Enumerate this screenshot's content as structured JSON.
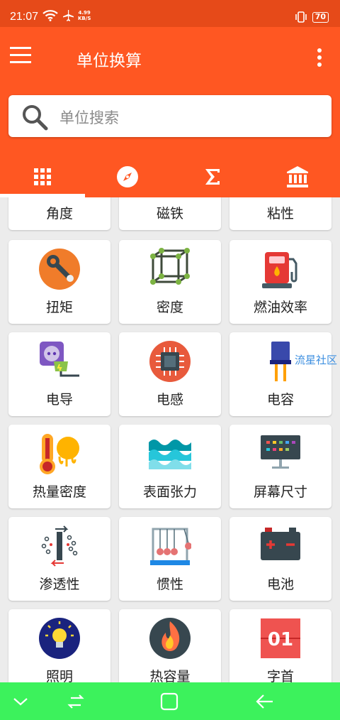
{
  "status_bar": {
    "time": "21:07",
    "net_speed_value": "4.99",
    "net_speed_unit": "KB/S",
    "battery": "70"
  },
  "app_bar": {
    "title": "单位换算",
    "search_placeholder": "单位搜索"
  },
  "tabs": [
    {
      "icon": "grid-icon",
      "active": true
    },
    {
      "icon": "compass-icon",
      "active": false
    },
    {
      "icon": "sigma-icon",
      "active": false
    },
    {
      "icon": "bank-icon",
      "active": false
    }
  ],
  "units_partial_row": [
    {
      "label": "角度"
    },
    {
      "label": "磁铁"
    },
    {
      "label": "粘性"
    }
  ],
  "units": [
    {
      "label": "扭矩",
      "icon": "wrench-gear-icon"
    },
    {
      "label": "密度",
      "icon": "cube-frame-icon"
    },
    {
      "label": "燃油效率",
      "icon": "fuel-pump-icon"
    },
    {
      "label": "电导",
      "icon": "plug-socket-icon"
    },
    {
      "label": "电感",
      "icon": "chip-icon"
    },
    {
      "label": "电容",
      "icon": "capacitor-icon"
    },
    {
      "label": "热量密度",
      "icon": "thermometer-sun-icon"
    },
    {
      "label": "表面张力",
      "icon": "waves-icon"
    },
    {
      "label": "屏幕尺寸",
      "icon": "monitor-icon"
    },
    {
      "label": "渗透性",
      "icon": "permeability-icon"
    },
    {
      "label": "惯性",
      "icon": "newton-cradle-icon"
    },
    {
      "label": "电池",
      "icon": "battery-icon"
    },
    {
      "label": "照明",
      "icon": "light-bulb-icon"
    },
    {
      "label": "热容量",
      "icon": "flame-icon"
    },
    {
      "label": "字首",
      "icon": "prefix-01-icon"
    }
  ],
  "watermark": "流星社区",
  "colors": {
    "status_bar": "#e64a19",
    "app_bar": "#ff5722",
    "nav_bar": "#3cf25c",
    "background": "#ececec"
  },
  "prefix_icon_text": "01"
}
